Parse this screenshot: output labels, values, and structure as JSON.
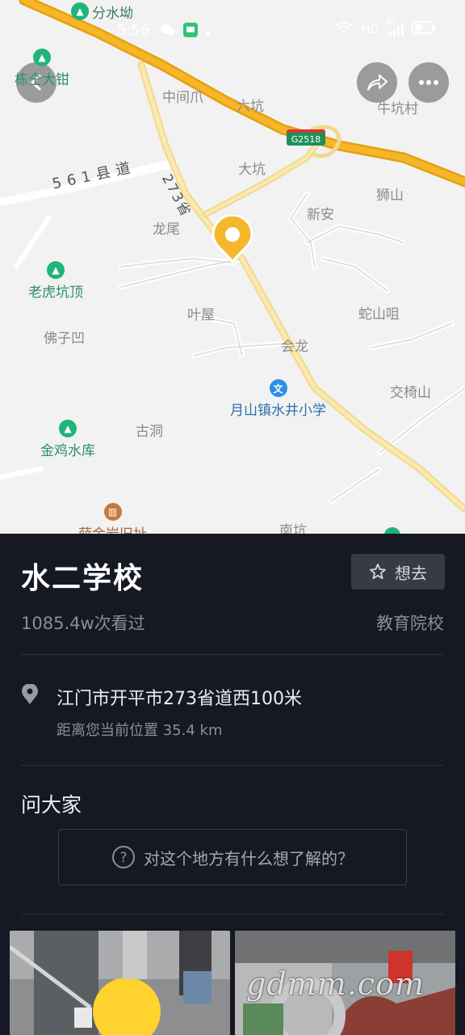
{
  "status_bar": {
    "time": "5:56",
    "network_label": "HD",
    "signal_label": "4G"
  },
  "map": {
    "places": [
      {
        "name": "中间爪"
      },
      {
        "name": "六坑"
      },
      {
        "name": "牛坑村"
      },
      {
        "name": "大坑"
      },
      {
        "name": "狮山"
      },
      {
        "name": "新安"
      },
      {
        "name": "龙尾"
      },
      {
        "name": "叶屋"
      },
      {
        "name": "蛇山咀"
      },
      {
        "name": "佛子凹"
      },
      {
        "name": "会龙"
      },
      {
        "name": "交椅山"
      },
      {
        "name": "古洞"
      },
      {
        "name": "南坑"
      }
    ],
    "pois": {
      "fenshuiao": "分水坳",
      "dongzhongdaqian": "栋仝大钳",
      "laohukengding": "老虎坑顶",
      "jinjishuiku": "金鸡水库",
      "school": "月山镇水井小学",
      "heritage": "薛金岩旧址"
    },
    "road_labels": {
      "county_road": "561县道",
      "provincial_road": "273省",
      "expressway_shield": "G2518"
    }
  },
  "place": {
    "name": "水二学校",
    "want_label": "想去",
    "views": "1085.4w次看过",
    "category": "教育院校",
    "address": "江门市开平市273省道西100米",
    "distance": "距离您当前位置 35.4 km"
  },
  "ask": {
    "title": "问大家",
    "placeholder": "对这个地方有什么想了解的？"
  },
  "watermark": "gdmm.com"
}
